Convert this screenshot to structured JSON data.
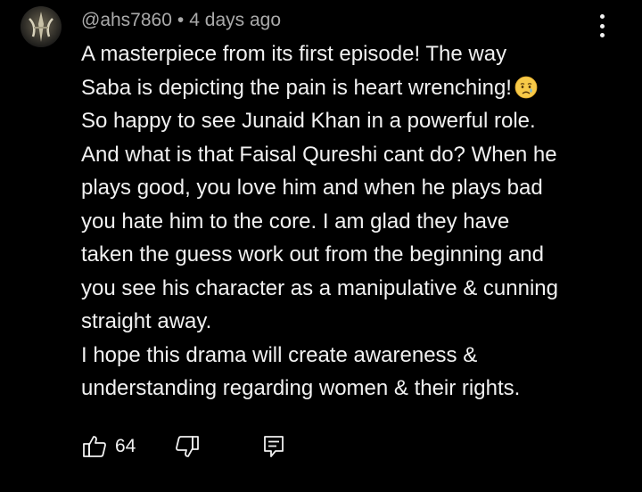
{
  "comment": {
    "author": "@ahs7860",
    "separator": "•",
    "timestamp": "4 days ago",
    "lines": [
      "A masterpiece from its first episode! The way",
      "Saba is depicting the pain is heart wrenching!",
      "So happy to see Junaid Khan in a powerful role.",
      "And what is that Faisal Qureshi cant do? When he",
      "plays good, you love him and when he plays bad",
      "you hate him to the core. I am glad they have",
      "taken the guess work out from the beginning and",
      "you see his character as a manipulative & cunning",
      "straight away.",
      "I hope this drama will create awareness &",
      "understanding regarding women & their rights."
    ],
    "emoji_after_line_2": "crying-face-emoji",
    "like_count": "64"
  },
  "icons": {
    "avatar": "avatar",
    "menu": "more-vertical-icon",
    "like": "thumbs-up-icon",
    "dislike": "thumbs-down-icon",
    "reply": "reply-comment-icon"
  },
  "colors": {
    "background": "#000000",
    "text": "#f1f1f1",
    "meta": "#aaaaaa"
  }
}
